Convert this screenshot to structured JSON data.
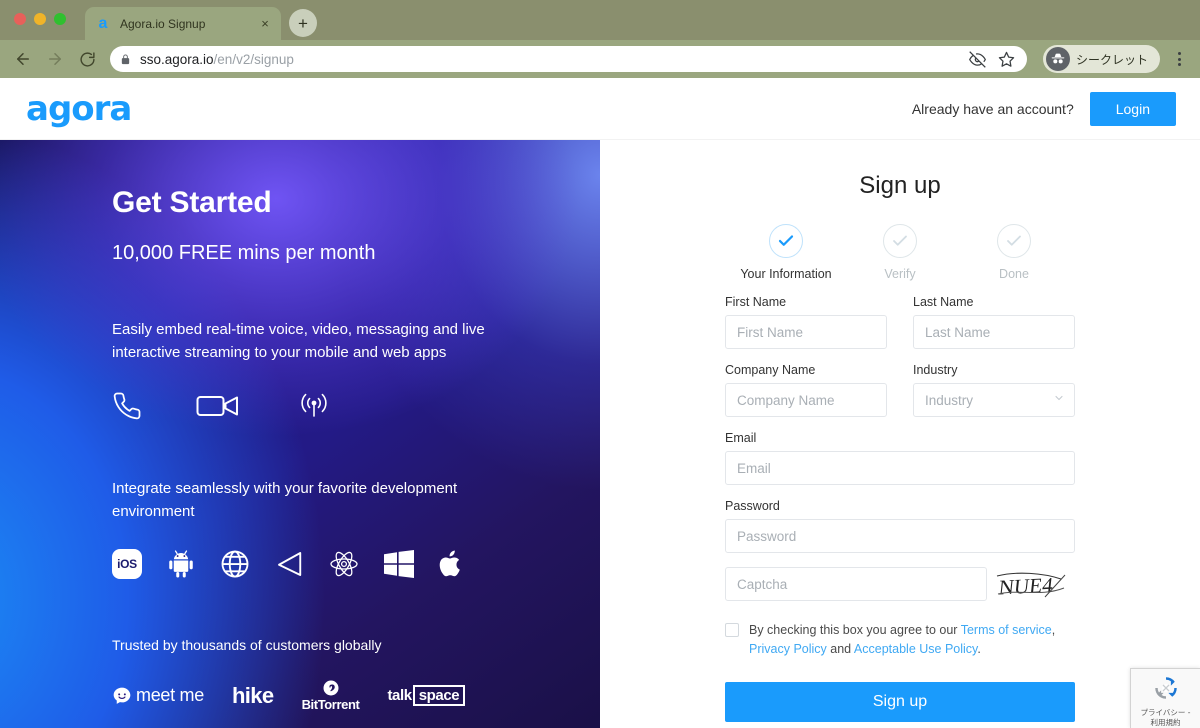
{
  "browser": {
    "tab": {
      "title": "Agora.io Signup",
      "favicon": "agora-a-icon",
      "close": "×"
    },
    "newtab_label": "+",
    "nav": {
      "back": "back-arrow-icon",
      "forward": "forward-arrow-icon",
      "reload": "reload-icon"
    },
    "omnibox": {
      "lock": "lock-icon",
      "url_domain": "sso.agora.io",
      "url_path": "/en/v2/signup",
      "full_url": "sso.agora.io/en/v2/signup",
      "actions": [
        "eye-slash-icon",
        "star-icon"
      ]
    },
    "incognito": {
      "label": "シークレット",
      "icon": "incognito-hat-icon"
    },
    "menu": "three-dots-menu-icon",
    "chrome_color": "#9aa67f"
  },
  "site_header": {
    "logo_text": "agora",
    "logo_color": "#1a9bfc",
    "have_account": "Already have an account?",
    "login_label": "Login"
  },
  "hero": {
    "title": "Get Started",
    "subtitle": "10,000 FREE mins per month",
    "description": "Easily embed real-time voice, video, messaging and live interactive streaming to your mobile and web apps",
    "media_icons": [
      "phone-icon",
      "video-camera-icon",
      "broadcast-signal-icon"
    ],
    "integrate_text": "Integrate seamlessly with your favorite development environment",
    "platforms": [
      {
        "name": "ios-icon",
        "label": "iOS"
      },
      {
        "name": "android-icon",
        "label": "Android"
      },
      {
        "name": "web-globe-icon",
        "label": "Web"
      },
      {
        "name": "unity-icon",
        "label": "Unity"
      },
      {
        "name": "react-icon",
        "label": "React"
      },
      {
        "name": "windows-icon",
        "label": "Windows"
      },
      {
        "name": "apple-icon",
        "label": "macOS"
      }
    ],
    "trusted_text": "Trusted by thousands of customers globally",
    "customers": [
      {
        "name": "meetme-logo",
        "label": "meet me"
      },
      {
        "name": "hike-logo",
        "label": "hike"
      },
      {
        "name": "bittorrent-logo",
        "label": "BitTorrent"
      },
      {
        "name": "talkspace-logo",
        "label_a": "talk",
        "label_b": "space"
      }
    ]
  },
  "form": {
    "title": "Sign up",
    "steps": [
      {
        "label": "Your Information",
        "state": "active"
      },
      {
        "label": "Verify",
        "state": "inactive"
      },
      {
        "label": "Done",
        "state": "inactive"
      }
    ],
    "fields": {
      "first_name": {
        "label": "First Name",
        "placeholder": "First Name",
        "value": ""
      },
      "last_name": {
        "label": "Last Name",
        "placeholder": "Last Name",
        "value": ""
      },
      "company_name": {
        "label": "Company Name",
        "placeholder": "Company Name",
        "value": ""
      },
      "industry": {
        "label": "Industry",
        "placeholder": "Industry",
        "value": ""
      },
      "email": {
        "label": "Email",
        "placeholder": "Email",
        "value": ""
      },
      "password": {
        "label": "Password",
        "placeholder": "Password",
        "value": ""
      },
      "captcha": {
        "placeholder": "Captcha",
        "value": "",
        "image_text": "NUE4"
      }
    },
    "terms": {
      "prefix": "By checking this box you agree to our ",
      "link_terms": "Terms of service",
      "comma": ", ",
      "link_privacy": "Privacy Policy",
      "and": " and ",
      "link_aup": "Acceptable Use Policy",
      "period": ".",
      "checked": false
    },
    "submit_label": "Sign up",
    "accent_color": "#1a9bfc"
  },
  "recaptcha": {
    "line1": "プライバシー -",
    "line2": "利用規約",
    "icon": "recaptcha-logo-icon"
  }
}
